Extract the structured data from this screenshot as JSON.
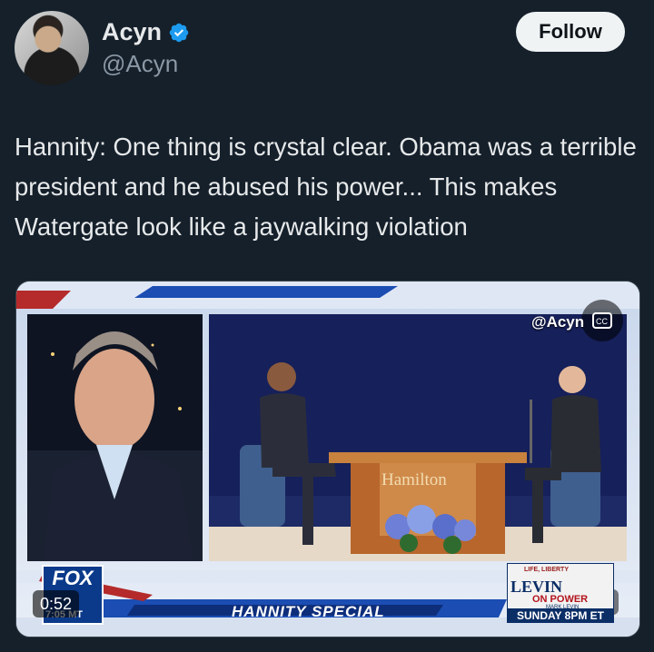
{
  "user": {
    "name": "Acyn",
    "handle": "@Acyn",
    "follow_label": "Follow"
  },
  "tweet": {
    "text": "Hannity: One thing is crystal clear. Obama was a terrible president and he abused his power... This makes Watergate look like a jaywalking violation"
  },
  "video": {
    "handle_overlay": "@Acyn",
    "hamilton_label": "Hamilton",
    "show_title": "HANNITY SPECIAL",
    "fox_logo": "FOX",
    "fox_logo_suffix": "S",
    "fox_time": "7:05 MT",
    "duration": "0:52",
    "promo": {
      "life": "LIFE, LIBERTY",
      "levin": "LEVIN",
      "on_power": "ON POWER",
      "mark": "MARK LEVIN",
      "sunday": "SUNDAY 8PM ET"
    }
  },
  "colors": {
    "background": "#15202b",
    "verified": "#1d9bf0",
    "follow_bg": "#eff3f4",
    "secondary_text": "#8b98a5"
  },
  "icons": [
    "verified-badge-icon",
    "closed-captions-icon",
    "mute-icon"
  ]
}
